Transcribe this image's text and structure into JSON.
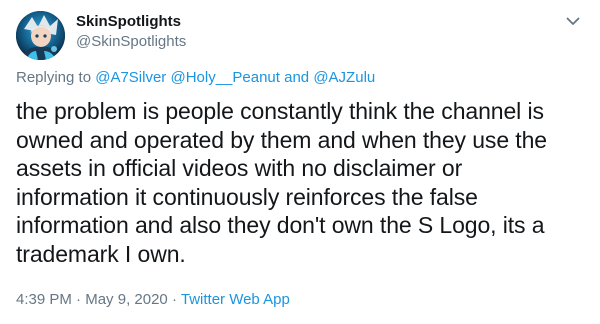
{
  "author": {
    "display_name": "SkinSpotlights",
    "handle": "@SkinSpotlights"
  },
  "reply": {
    "prefix": "Replying to",
    "mention_1": "@A7Silver",
    "mention_2": "@Holy__Peanut",
    "and_text": "and",
    "mention_3": "@AJZulu"
  },
  "tweet": {
    "line_1": "the problem is people constantly think the channel is",
    "line_2": "owned and operated by them and when they use the",
    "line_3": "assets in official videos with no disclaimer or",
    "line_4": "information it continuously reinforces the false",
    "line_5": "information and also they don't own the S Logo, its a",
    "line_6": "trademark I own."
  },
  "meta": {
    "time": "4:39 PM",
    "separator_1": "·",
    "date": "May 9, 2020",
    "separator_2": "·",
    "source": "Twitter Web App"
  },
  "icons": {
    "caret": "chevron-down-icon",
    "avatar": "avatar"
  },
  "colors": {
    "link": "#1b95e0",
    "secondary_text": "#657786",
    "primary_text": "#14171a"
  }
}
